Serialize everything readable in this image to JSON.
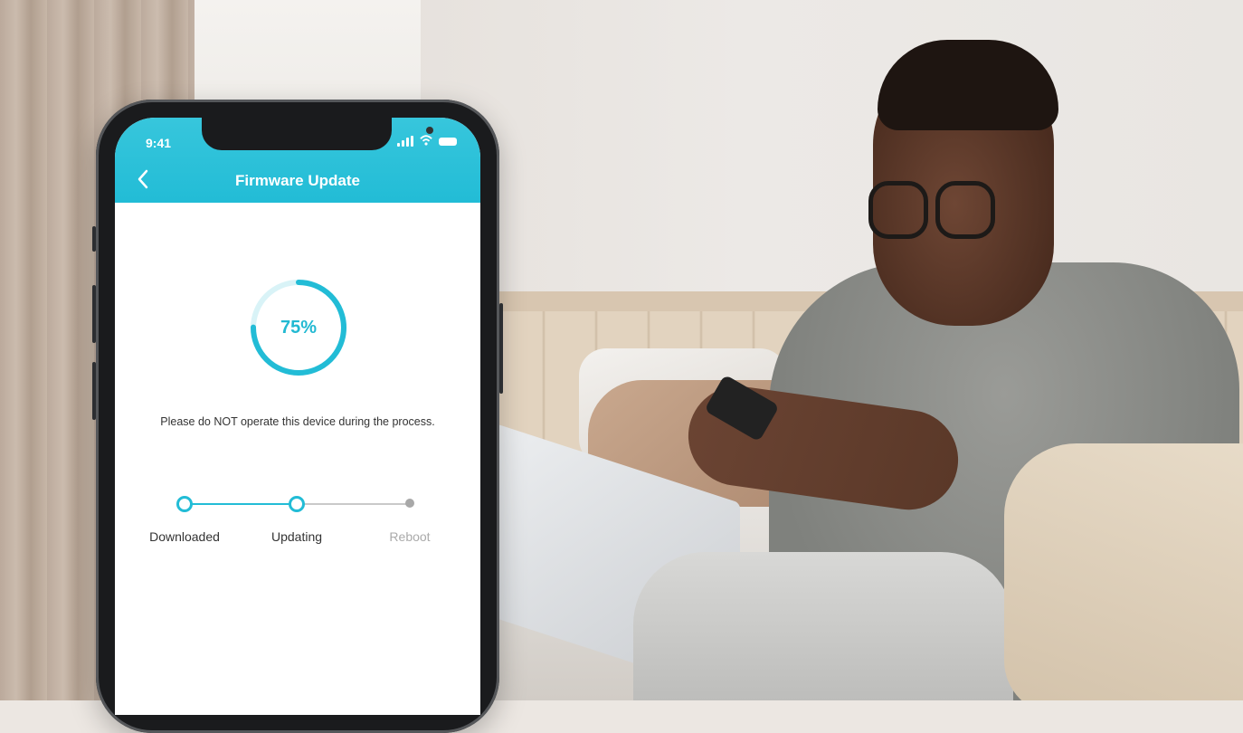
{
  "app": {
    "status_bar": {
      "time": "9:41"
    },
    "header": {
      "title": "Firmware Update"
    },
    "progress": {
      "value_text": "75%",
      "fraction": 0.75
    },
    "message": "Please do NOT operate this device during the process.",
    "steps": [
      {
        "label": "Downloaded",
        "state": "done"
      },
      {
        "label": "Updating",
        "state": "active"
      },
      {
        "label": "Reboot",
        "state": "pending"
      }
    ]
  },
  "colors": {
    "accent": "#22bcd6",
    "header_bg": "#2cc1d8",
    "pending": "#aaaaaa"
  },
  "icons": [
    "back-chevron-icon",
    "signal-icon",
    "wifi-icon",
    "battery-icon"
  ]
}
